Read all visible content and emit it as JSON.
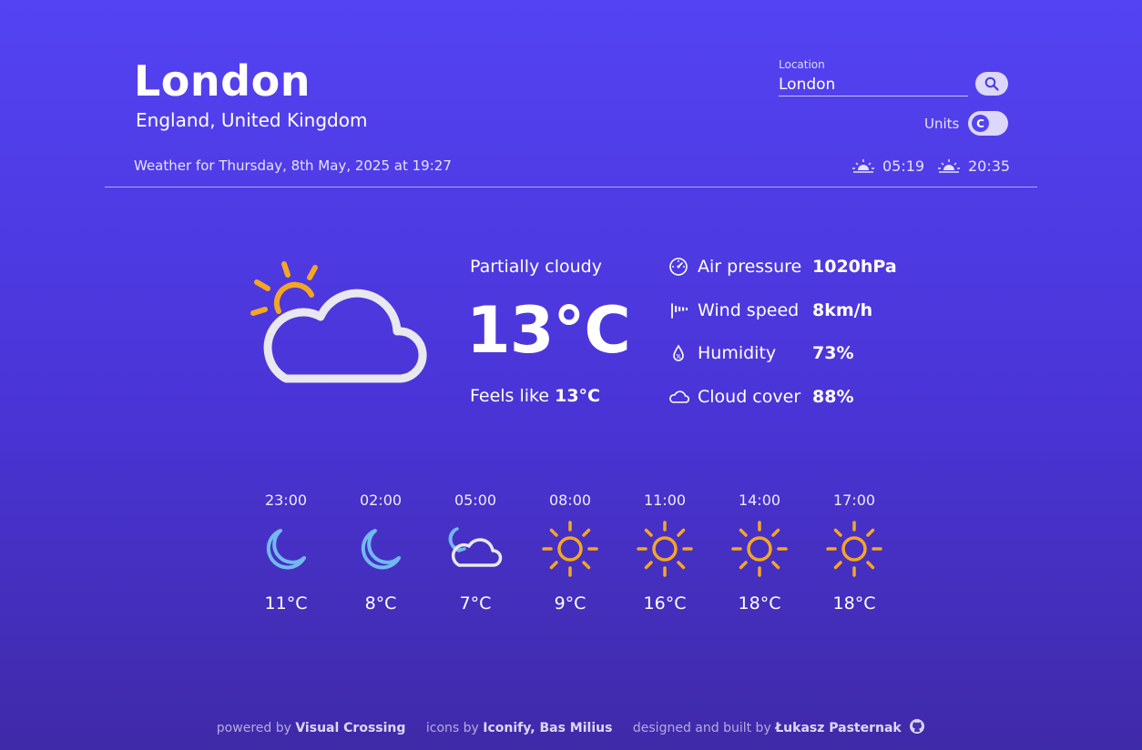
{
  "location": {
    "city": "London",
    "country": "England, United Kingdom",
    "weather_for": "Weather for Thursday, 8th May, 2025 at 19:27"
  },
  "search": {
    "label": "Location",
    "value": "London",
    "icon": "search-icon"
  },
  "units": {
    "label": "Units",
    "selected": "C"
  },
  "sun": {
    "sunrise": "05:19",
    "sunset": "20:35"
  },
  "current": {
    "condition": "Partially cloudy",
    "temperature": "13°C",
    "feels_label": "Feels like",
    "feels_value": "13°C",
    "icon": "partly-cloudy-day-icon"
  },
  "details": [
    {
      "label": "Air pressure",
      "value": "1020hPa",
      "icon": "pressure-gauge-icon"
    },
    {
      "label": "Wind speed",
      "value": "8km/h",
      "icon": "windsock-icon"
    },
    {
      "label": "Humidity",
      "value": "73%",
      "icon": "humidity-drop-icon"
    },
    {
      "label": "Cloud cover",
      "value": "88%",
      "icon": "cloud-icon"
    }
  ],
  "hourly": [
    {
      "time": "23:00",
      "temp": "11°C",
      "icon": "moon-icon"
    },
    {
      "time": "02:00",
      "temp": "8°C",
      "icon": "moon-icon"
    },
    {
      "time": "05:00",
      "temp": "7°C",
      "icon": "partly-cloudy-night-icon"
    },
    {
      "time": "08:00",
      "temp": "9°C",
      "icon": "sun-icon"
    },
    {
      "time": "11:00",
      "temp": "16°C",
      "icon": "sun-icon"
    },
    {
      "time": "14:00",
      "temp": "18°C",
      "icon": "sun-icon"
    },
    {
      "time": "17:00",
      "temp": "18°C",
      "icon": "sun-icon"
    }
  ],
  "footer": {
    "powered_prefix": "powered by",
    "powered_name": "Visual Crossing",
    "icons_prefix": "icons by",
    "icons_name": "Iconify, Bas Milius",
    "built_prefix": "designed and built by",
    "built_name": "Łukasz Pasternak"
  },
  "colors": {
    "bg_top": "#5443f3",
    "bg_bottom": "#3f2aa8",
    "sun": "#f5a623",
    "moon": "#72b9f0",
    "cloud": "#e8e8ee"
  }
}
